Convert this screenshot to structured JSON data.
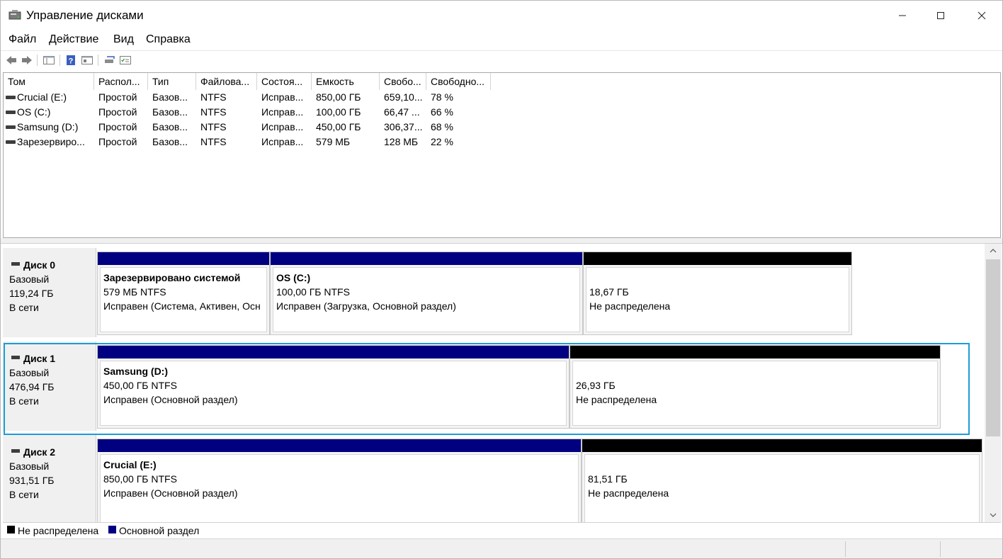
{
  "window": {
    "title": "Управление дисками",
    "controls": {
      "minimize": "─",
      "maximize": "☐",
      "close": "✕"
    }
  },
  "menu": [
    "Файл",
    "Действие",
    "Вид",
    "Справка"
  ],
  "toolbar": {
    "icons": [
      "back-icon",
      "forward-icon",
      "console-tree-icon",
      "help-icon",
      "properties-icon",
      "rescan-icon",
      "checklist-icon"
    ]
  },
  "volume_list": {
    "columns": [
      "Том",
      "Распол...",
      "Тип",
      "Файлова...",
      "Состоя...",
      "Емкость",
      "Свобо...",
      "Свободно..."
    ],
    "rows": [
      [
        "Crucial (E:)",
        "Простой",
        "Базов...",
        "NTFS",
        "Исправ...",
        "850,00 ГБ",
        "659,10...",
        "78 %"
      ],
      [
        "OS (C:)",
        "Простой",
        "Базов...",
        "NTFS",
        "Исправ...",
        "100,00 ГБ",
        "66,47 ...",
        "66 %"
      ],
      [
        "Samsung (D:)",
        "Простой",
        "Базов...",
        "NTFS",
        "Исправ...",
        "450,00 ГБ",
        "306,37...",
        "68 %"
      ],
      [
        "Зарезервиро...",
        "Простой",
        "Базов...",
        "NTFS",
        "Исправ...",
        "579 МБ",
        "128 МБ",
        "22 %"
      ]
    ]
  },
  "disks": [
    {
      "name": "Диск 0",
      "type": "Базовый",
      "size": "119,24 ГБ",
      "status": "В сети",
      "partitions": [
        {
          "kind": "primary",
          "name": "Зарезервировано системой",
          "size": "579 МБ NTFS",
          "status": "Исправен (Система, Активен, Осн"
        },
        {
          "kind": "primary",
          "name": "OS  (C:)",
          "size": "100,00 ГБ NTFS",
          "status": "Исправен (Загрузка, Основной раздел)"
        },
        {
          "kind": "unalloc",
          "name": "",
          "size": "18,67 ГБ",
          "status": "Не распределена"
        }
      ]
    },
    {
      "name": "Диск 1",
      "type": "Базовый",
      "size": "476,94 ГБ",
      "status": "В сети",
      "partitions": [
        {
          "kind": "primary",
          "name": "Samsung  (D:)",
          "size": "450,00 ГБ NTFS",
          "status": "Исправен (Основной раздел)"
        },
        {
          "kind": "unalloc",
          "name": "",
          "size": "26,93 ГБ",
          "status": "Не распределена"
        }
      ]
    },
    {
      "name": "Диск 2",
      "type": "Базовый",
      "size": "931,51 ГБ",
      "status": "В сети",
      "partitions": [
        {
          "kind": "primary",
          "name": "Crucial  (E:)",
          "size": "850,00 ГБ NTFS",
          "status": "Исправен (Основной раздел)"
        },
        {
          "kind": "unalloc",
          "name": "",
          "size": "81,51 ГБ",
          "status": "Не распределена"
        }
      ]
    }
  ],
  "legend": {
    "unallocated": {
      "label": "Не распределена",
      "color": "#000000"
    },
    "primary": {
      "label": "Основной раздел",
      "color": "#000080"
    }
  },
  "selection_color": "#1d9bd7"
}
